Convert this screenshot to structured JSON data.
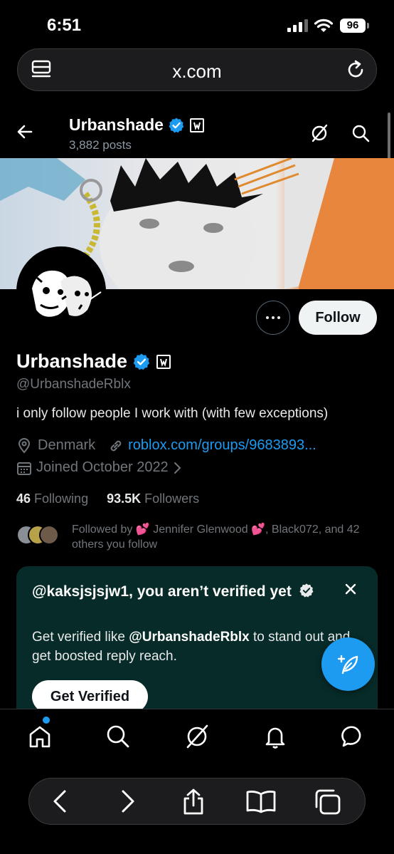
{
  "status_bar": {
    "time": "6:51",
    "battery": "96"
  },
  "browser": {
    "domain": "x.com"
  },
  "header": {
    "name": "Urbanshade",
    "posts": "3,882 posts"
  },
  "actions": {
    "follow_label": "Follow"
  },
  "profile": {
    "name": "Urbanshade",
    "handle": "@UrbanshadeRblx",
    "bio": "i only follow people I work with (with few exceptions)",
    "location": "Denmark",
    "website": "roblox.com/groups/9683893...",
    "joined": "Joined October 2022",
    "following_count": "46",
    "following_label": "Following",
    "followers_count": "93.5K",
    "followers_label": "Followers",
    "followed_by_prefix": "Followed by",
    "followed_by_name1": "Jennifer Glenwood",
    "followed_by_rest": ", Black072, and 42 others you follow"
  },
  "verify_card": {
    "title": "@kaksjsjsjw1, you aren’t verified yet",
    "desc_prefix": "Get verified like",
    "desc_handle": "@UrbanshadeRblx",
    "desc_suffix": "to stand out and get boosted reply reach.",
    "button": "Get Verified"
  },
  "tabbar": {
    "items": [
      "home-icon",
      "search-icon",
      "grok-icon",
      "notifications-icon",
      "messages-icon"
    ]
  },
  "toolbar": {
    "items": [
      "back-icon",
      "forward-icon",
      "share-icon",
      "bookmarks-icon",
      "tabs-icon"
    ]
  },
  "colors": {
    "accent": "#1d9bf0",
    "card_bg": "#072b28",
    "background": "#000000"
  }
}
